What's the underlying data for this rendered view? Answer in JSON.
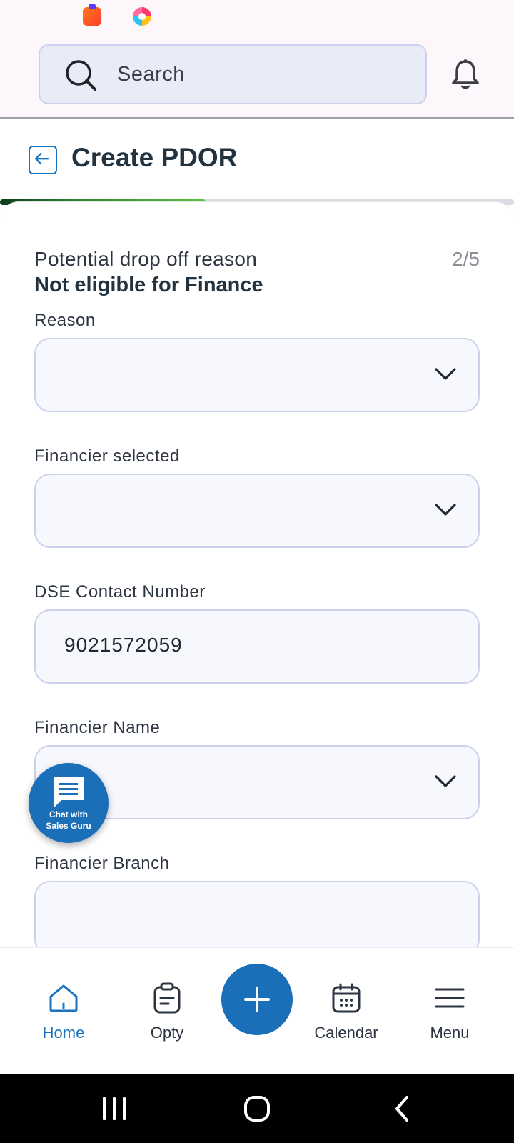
{
  "header": {
    "search_placeholder": "Search",
    "icons": [
      "search-icon",
      "bell-icon"
    ]
  },
  "page": {
    "title": "Create PDOR",
    "step_progress": 0.4
  },
  "section": {
    "label": "Potential drop off reason",
    "value": "Not eligible for Finance",
    "step": "2/5"
  },
  "fields": [
    {
      "label": "Reason",
      "value": "",
      "type": "dropdown"
    },
    {
      "label": "Financier selected",
      "value": "",
      "type": "dropdown"
    },
    {
      "label": "DSE Contact Number",
      "value": "9021572059",
      "type": "text"
    },
    {
      "label": "Financier Name",
      "value": "",
      "type": "dropdown"
    },
    {
      "label": "Financier Branch",
      "value": "",
      "type": "text"
    }
  ],
  "chat_fab": {
    "line1": "Chat with",
    "line2": "Sales Guru"
  },
  "bottom_nav": {
    "active": "Home",
    "items": [
      {
        "label": "Home",
        "icon": "home-icon"
      },
      {
        "label": "Opty",
        "icon": "clipboard-icon"
      },
      {
        "label": "Calendar",
        "icon": "calendar-icon"
      },
      {
        "label": "Menu",
        "icon": "hamburger-icon"
      }
    ],
    "center_action_icon": "plus-icon"
  },
  "colors": {
    "accent": "#1a6fb8",
    "progress_start": "#0e3d1c",
    "progress_end": "#57c43a",
    "field_border": "#c9d2ea"
  }
}
